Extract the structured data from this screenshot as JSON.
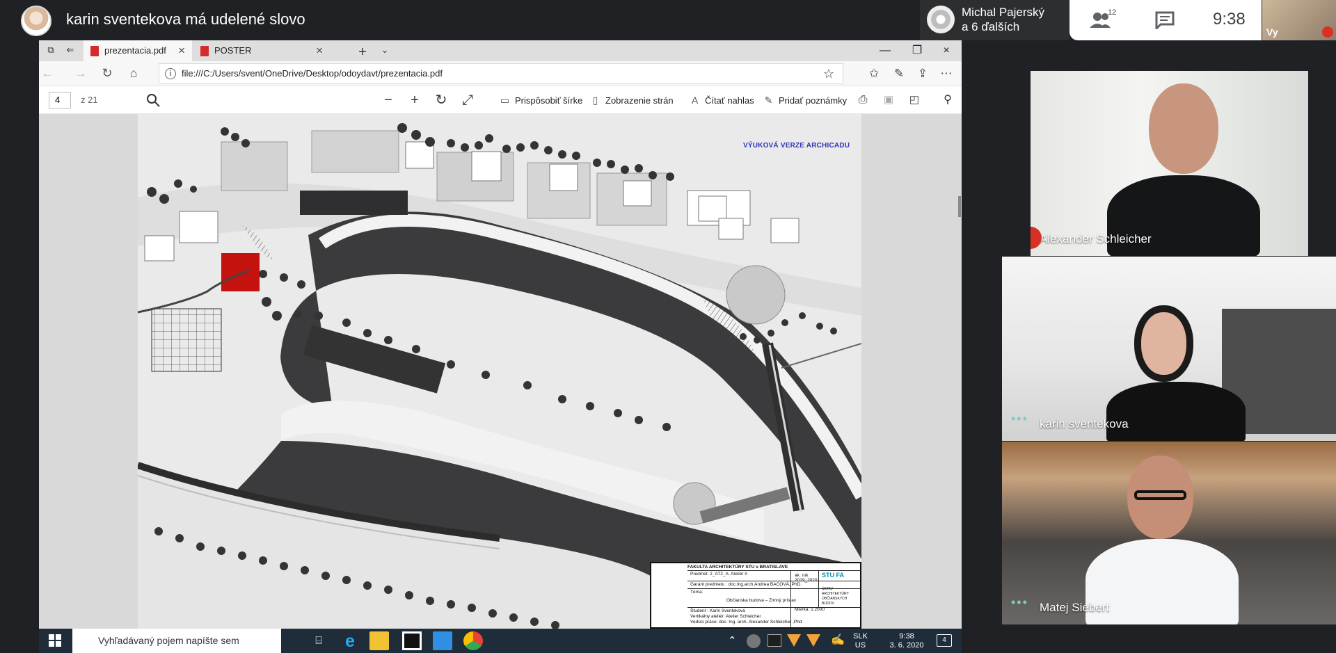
{
  "meet": {
    "presenter_status": "karin sventekova má udelené slovo",
    "others": {
      "line1": "Michal Pajerský",
      "line2": "a 6 ďalších"
    },
    "participant_count": "12",
    "time": "9:38",
    "self_label": "Vy"
  },
  "browser": {
    "tabs": [
      {
        "label": "prezentacia.pdf",
        "active": true
      },
      {
        "label": "POSTER SVENTEKOVÁ.pdf",
        "active": false
      }
    ],
    "url": "file:///C:/Users/svent/OneDrive/Desktop/odoydavt/prezentacia.pdf",
    "pdf_toolbar": {
      "page_number": "4",
      "page_total": "z 21",
      "fit_width": "Prispôsobiť šírke",
      "page_view": "Zobrazenie strán",
      "read_aloud": "Čítať nahlas",
      "add_notes": "Pridať poznámky"
    }
  },
  "pdf": {
    "watermark": "VÝUKOVÁ VERZE ARCHICADU",
    "title_block": {
      "school": "FAKULTA ARCHITEKTÚRY STU v BRATISLAVE",
      "logo": "STU FA",
      "subject": "Predmet:  2_AT2_A: Ateliér II",
      "year": "ak. rok",
      "year_value": "2019_2020",
      "guarantor": "Garant predmetu :   doc.Ing.arch.Andrea BACOVÁ, PhD.",
      "ustav": "ÚSTAV ARCHITEKTÚRY OBČIANSKYCH BUDOV",
      "theme_label": "Téma:",
      "theme": "Občianska budova – Zimný prístav",
      "student": "Študent : Karin Sventeková",
      "studio": "Vertikálny ateliér: Atelier Schleicher",
      "supervisor": "Vedúci práce: doc. Ing. arch. Alexander Schleicher ,Phd",
      "scale": "Mierka: 1:2000"
    }
  },
  "taskbar": {
    "search_placeholder": "Vyhľadávaný pojem napíšte sem",
    "language": "SLK",
    "layout": "US",
    "time": "9:38",
    "date": "3. 6. 2020",
    "notifications": "4"
  },
  "participants": [
    {
      "name": "Alexander Schleicher",
      "muted": true
    },
    {
      "name": "karin sventekova",
      "muted": false
    },
    {
      "name": "Matej Siebert",
      "muted": false
    }
  ],
  "colors": {
    "meet_bg": "#202124",
    "mute_red": "#d93025",
    "water": "#3b3b3d",
    "highlight_building": "#c4120f"
  }
}
